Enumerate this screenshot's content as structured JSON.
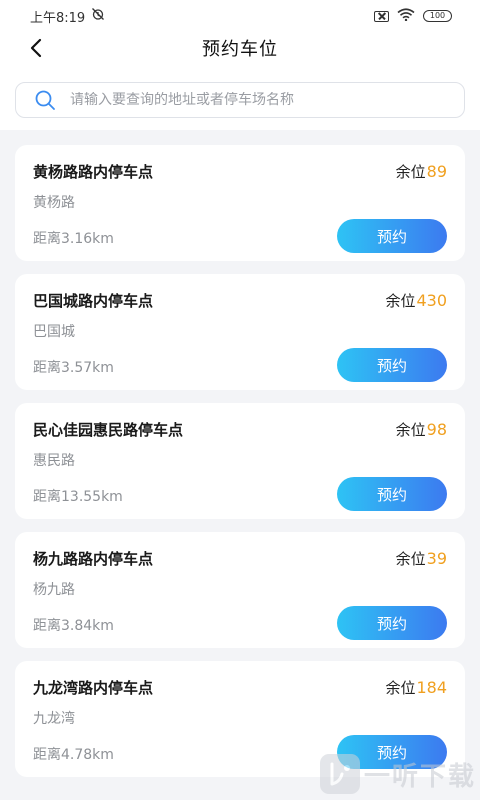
{
  "status_bar": {
    "time": "上午8:19",
    "battery": "100"
  },
  "header": {
    "title": "预约车位"
  },
  "search": {
    "placeholder": "请输入要查询的地址或者停车场名称",
    "value": ""
  },
  "parking_list": [
    {
      "name": "黄杨路路内停车点",
      "address": "黄杨路",
      "distance": "距离3.16km",
      "avail_label": "余位",
      "avail": "89",
      "button": "预约"
    },
    {
      "name": "巴国城路内停车点",
      "address": "巴国城",
      "distance": "距离3.57km",
      "avail_label": "余位",
      "avail": "430",
      "button": "预约"
    },
    {
      "name": "民心佳园惠民路停车点",
      "address": "惠民路",
      "distance": "距离13.55km",
      "avail_label": "余位",
      "avail": "98",
      "button": "预约"
    },
    {
      "name": "杨九路路内停车点",
      "address": "杨九路",
      "distance": "距离3.84km",
      "avail_label": "余位",
      "avail": "39",
      "button": "预约"
    },
    {
      "name": "九龙湾路内停车点",
      "address": "九龙湾",
      "distance": "距离4.78km",
      "avail_label": "余位",
      "avail": "184",
      "button": "预约"
    }
  ],
  "watermark": {
    "text": "一听下载"
  },
  "colors": {
    "accent_orange": "#f0a020",
    "button_gradient_start": "#2ec3f4",
    "button_gradient_end": "#3c7af0"
  }
}
